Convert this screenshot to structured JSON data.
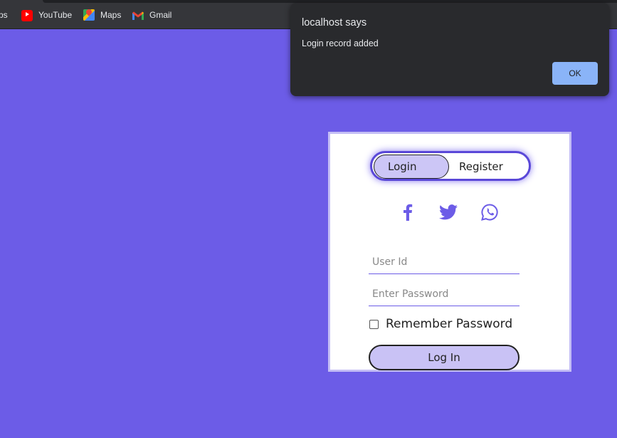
{
  "bookmarks": {
    "apps_partial": "ps",
    "items": [
      {
        "label": "YouTube"
      },
      {
        "label": "Maps"
      },
      {
        "label": "Gmail"
      }
    ]
  },
  "alert": {
    "title": "localhost says",
    "message": "Login record added",
    "ok_label": "OK"
  },
  "form": {
    "tabs": {
      "login": "Login",
      "register": "Register",
      "active": "login"
    },
    "social_icons": [
      "facebook-icon",
      "twitter-icon",
      "whatsapp-icon"
    ],
    "user_id_placeholder": "User Id",
    "password_placeholder": "Enter Password",
    "remember_label": "Remember Password",
    "remember_checked": false,
    "submit_label": "Log In"
  },
  "colors": {
    "background": "#6c5ce7",
    "accent": "#6c5ce7",
    "pill": "#ccc6f6",
    "dialog": "#292a2d",
    "dialog_button": "#8ab4f8"
  }
}
